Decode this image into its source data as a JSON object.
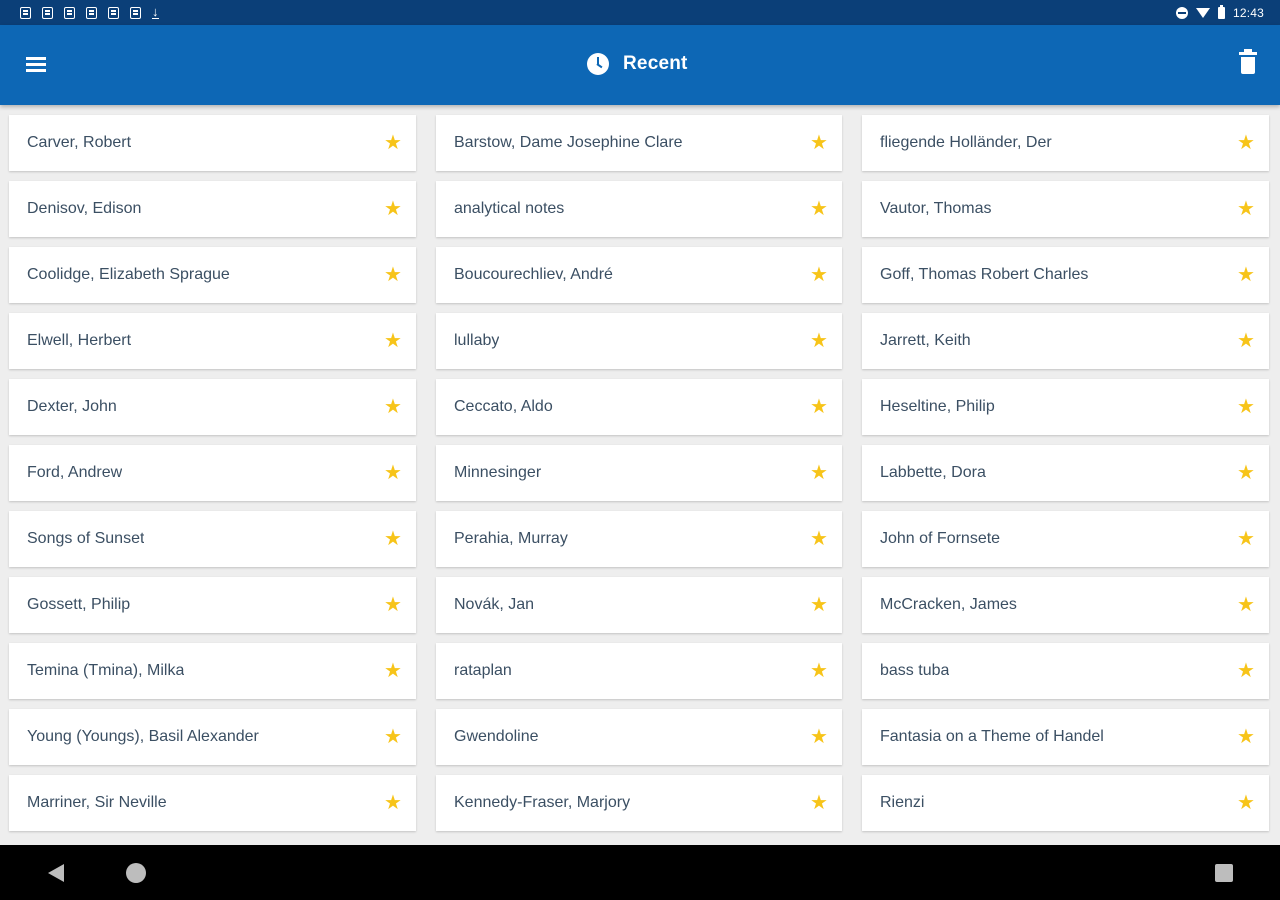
{
  "status_bar": {
    "time": "12:43",
    "notification_icons": [
      "notification-icon",
      "notification-icon",
      "notification-icon",
      "notification-icon",
      "notification-icon",
      "image-icon",
      "download-icon"
    ],
    "system_icons": [
      "do-not-disturb-icon",
      "wifi-icon",
      "battery-icon"
    ]
  },
  "app_bar": {
    "title": "Recent",
    "left_icon": "menu-icon",
    "title_icon": "clock-icon",
    "right_icon": "trash-icon",
    "background": "#0d67b5"
  },
  "colors": {
    "status_bar": "#0b3f78",
    "app_bar": "#0d67b5",
    "background": "#eeeeee",
    "card": "#ffffff",
    "label_text": "#3b4f63",
    "star": "#f7c419",
    "nav_bar": "#000000"
  },
  "items": [
    {
      "label": "Carver, Robert",
      "favorite": true
    },
    {
      "label": "Barstow, Dame Josephine Clare",
      "favorite": true
    },
    {
      "label": "fliegende Holländer, Der",
      "favorite": true
    },
    {
      "label": "Denisov, Edison",
      "favorite": true
    },
    {
      "label": "analytical notes",
      "favorite": true
    },
    {
      "label": "Vautor, Thomas",
      "favorite": true
    },
    {
      "label": "Coolidge, Elizabeth Sprague",
      "favorite": true
    },
    {
      "label": "Boucourechliev, André",
      "favorite": true
    },
    {
      "label": "Goff, Thomas Robert Charles",
      "favorite": true
    },
    {
      "label": "Elwell, Herbert",
      "favorite": true
    },
    {
      "label": "lullaby",
      "favorite": true
    },
    {
      "label": "Jarrett, Keith",
      "favorite": true
    },
    {
      "label": "Dexter, John",
      "favorite": true
    },
    {
      "label": "Ceccato, Aldo",
      "favorite": true
    },
    {
      "label": "Heseltine, Philip",
      "favorite": true
    },
    {
      "label": "Ford, Andrew",
      "favorite": true
    },
    {
      "label": "Minnesinger",
      "favorite": true
    },
    {
      "label": "Labbette, Dora",
      "favorite": true
    },
    {
      "label": "Songs of Sunset",
      "favorite": true
    },
    {
      "label": "Perahia, Murray",
      "favorite": true
    },
    {
      "label": "John of Fornsete",
      "favorite": true
    },
    {
      "label": "Gossett, Philip",
      "favorite": true
    },
    {
      "label": "Novák, Jan",
      "favorite": true
    },
    {
      "label": "McCracken, James",
      "favorite": true
    },
    {
      "label": "Temina (Tmina), Milka",
      "favorite": true
    },
    {
      "label": "rataplan",
      "favorite": true
    },
    {
      "label": "bass tuba",
      "favorite": true
    },
    {
      "label": "Young (Youngs), Basil Alexander",
      "favorite": true
    },
    {
      "label": "Gwendoline",
      "favorite": true
    },
    {
      "label": "Fantasia on a Theme of Handel",
      "favorite": true
    },
    {
      "label": "Marriner, Sir Neville",
      "favorite": true
    },
    {
      "label": "Kennedy-Fraser, Marjory",
      "favorite": true
    },
    {
      "label": "Rienzi",
      "favorite": true
    }
  ],
  "nav_bar": {
    "back_icon": "back-icon",
    "home_icon": "home-icon",
    "recents_icon": "recents-icon"
  }
}
